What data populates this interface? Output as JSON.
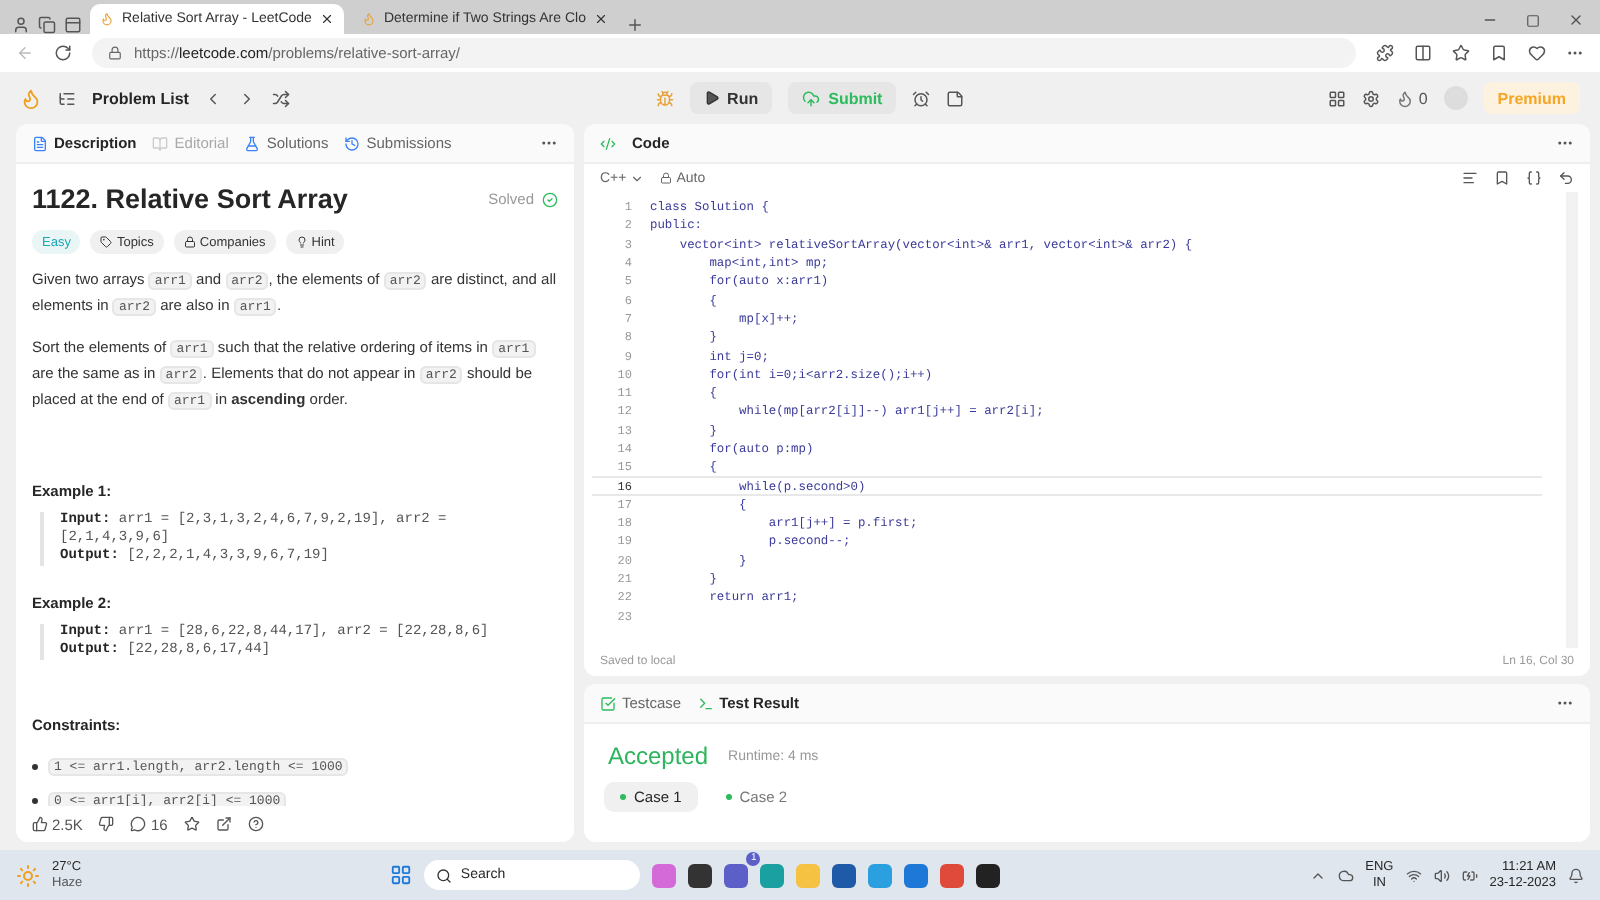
{
  "browser": {
    "tabs": [
      {
        "title": "Relative Sort Array - LeetCode",
        "selected": true
      },
      {
        "title": "Determine if Two Strings Are Clo",
        "selected": false
      }
    ],
    "url": "https://**leetcode.com**/problems/relative-sort-array/"
  },
  "header": {
    "problem_list": "Problem List",
    "run": "Run",
    "submit": "Submit",
    "streak": "0",
    "premium": "Premium"
  },
  "left_tabs": [
    {
      "label": "Description",
      "selected": true,
      "disabled": false
    },
    {
      "label": "Editorial",
      "selected": false,
      "disabled": true
    },
    {
      "label": "Solutions",
      "selected": false,
      "disabled": false
    },
    {
      "label": "Submissions",
      "selected": false,
      "disabled": false
    }
  ],
  "problem": {
    "title": "1122. Relative Sort Array",
    "status": "Solved",
    "tags": [
      {
        "label": "Easy",
        "kind": "difficulty"
      },
      {
        "label": "Topics",
        "kind": "topics"
      },
      {
        "label": "Companies",
        "kind": "companies"
      },
      {
        "label": "Hint",
        "kind": "hint"
      }
    ],
    "paragraphs": [
      [
        {
          "kind": "text",
          "text": "Given two arrays "
        },
        {
          "kind": "code",
          "text": "arr1"
        },
        {
          "kind": "text",
          "text": " and "
        },
        {
          "kind": "code",
          "text": "arr2"
        },
        {
          "kind": "text",
          "text": ", the elements of "
        },
        {
          "kind": "code",
          "text": "arr2"
        },
        {
          "kind": "text",
          "text": " are distinct, and all elements in "
        },
        {
          "kind": "code",
          "text": "arr2"
        },
        {
          "kind": "text",
          "text": " are also in "
        },
        {
          "kind": "code",
          "text": "arr1"
        },
        {
          "kind": "text",
          "text": "."
        }
      ],
      [
        {
          "kind": "text",
          "text": "Sort the elements of "
        },
        {
          "kind": "code",
          "text": "arr1"
        },
        {
          "kind": "text",
          "text": " such that the relative ordering of items in "
        },
        {
          "kind": "code",
          "text": "arr1"
        },
        {
          "kind": "text",
          "text": " are the same as in "
        },
        {
          "kind": "code",
          "text": "arr2"
        },
        {
          "kind": "text",
          "text": ". Elements that do not appear in "
        },
        {
          "kind": "code",
          "text": "arr2"
        },
        {
          "kind": "text",
          "text": " should be placed at the end of "
        },
        {
          "kind": "code",
          "text": "arr1"
        },
        {
          "kind": "text",
          "text": " in **ascending** order."
        }
      ]
    ],
    "examples": [
      {
        "heading": "Example 1:",
        "lines": [
          "**Input:** arr1 = [2,3,1,3,2,4,6,7,9,2,19], arr2 = [2,1,4,3,9,6]",
          "**Output:** [2,2,2,1,4,3,3,9,6,7,19]"
        ]
      },
      {
        "heading": "Example 2:",
        "lines": [
          "**Input:** arr1 = [28,6,22,8,44,17], arr2 = [22,28,8,6]",
          "**Output:** [22,28,8,6,17,44]"
        ]
      }
    ],
    "constraints_heading": "Constraints:",
    "constraints": [
      "1 <= arr1.length, arr2.length <= 1000",
      "0 <= arr1[i], arr2[i] <= 1000"
    ],
    "likes": "2.5K",
    "comments": "16"
  },
  "code": {
    "title": "Code",
    "language": "C++",
    "mode": "Auto",
    "lines": [
      {
        "no": "1",
        "text": "class Solution {",
        "highlighted": false
      },
      {
        "no": "2",
        "text": "public:",
        "highlighted": false
      },
      {
        "no": "3",
        "text": "    vector<int> relativeSortArray(vector<int>& arr1, vector<int>& arr2) {",
        "highlighted": false
      },
      {
        "no": "4",
        "text": "        map<int,int> mp;",
        "highlighted": false
      },
      {
        "no": "5",
        "text": "        for(auto x:arr1)",
        "highlighted": false
      },
      {
        "no": "6",
        "text": "        {",
        "highlighted": false
      },
      {
        "no": "7",
        "text": "            mp[x]++;",
        "highlighted": false
      },
      {
        "no": "8",
        "text": "        }",
        "highlighted": false
      },
      {
        "no": "9",
        "text": "        int j=0;",
        "highlighted": false
      },
      {
        "no": "10",
        "text": "        for(int i=0;i<arr2.size();i++)",
        "highlighted": false
      },
      {
        "no": "11",
        "text": "        {",
        "highlighted": false
      },
      {
        "no": "12",
        "text": "            while(mp[arr2[i]]--) arr1[j++] = arr2[i];",
        "highlighted": false
      },
      {
        "no": "13",
        "text": "        }",
        "highlighted": false
      },
      {
        "no": "14",
        "text": "        for(auto p:mp)",
        "highlighted": false
      },
      {
        "no": "15",
        "text": "        {",
        "highlighted": false
      },
      {
        "no": "16",
        "text": "            while(p.second>0)",
        "highlighted": true
      },
      {
        "no": "17",
        "text": "            {",
        "highlighted": false
      },
      {
        "no": "18",
        "text": "                arr1[j++] = p.first;",
        "highlighted": false
      },
      {
        "no": "19",
        "text": "                p.second--;",
        "highlighted": false
      },
      {
        "no": "20",
        "text": "            }",
        "highlighted": false
      },
      {
        "no": "21",
        "text": "        }",
        "highlighted": false
      },
      {
        "no": "22",
        "text": "        return arr1;",
        "highlighted": false
      },
      {
        "no": "23",
        "highlighted": false
      }
    ],
    "saved": "Saved to local",
    "cursor": "Ln 16, Col 30"
  },
  "result": {
    "tabs": [
      {
        "label": "Testcase",
        "selected": false
      },
      {
        "label": "Test Result",
        "selected": true
      }
    ],
    "verdict": "Accepted",
    "runtime": "Runtime: 4 ms",
    "cases": [
      {
        "label": "Case 1",
        "selected": true
      },
      {
        "label": "Case 2",
        "selected": false
      }
    ]
  },
  "taskbar": {
    "temperature": "27°C",
    "weather": "Haze",
    "search": "Search",
    "badge": "1",
    "lang": "ENG",
    "region": "IN",
    "time": "11:21 AM",
    "date": "23-12-2023"
  }
}
